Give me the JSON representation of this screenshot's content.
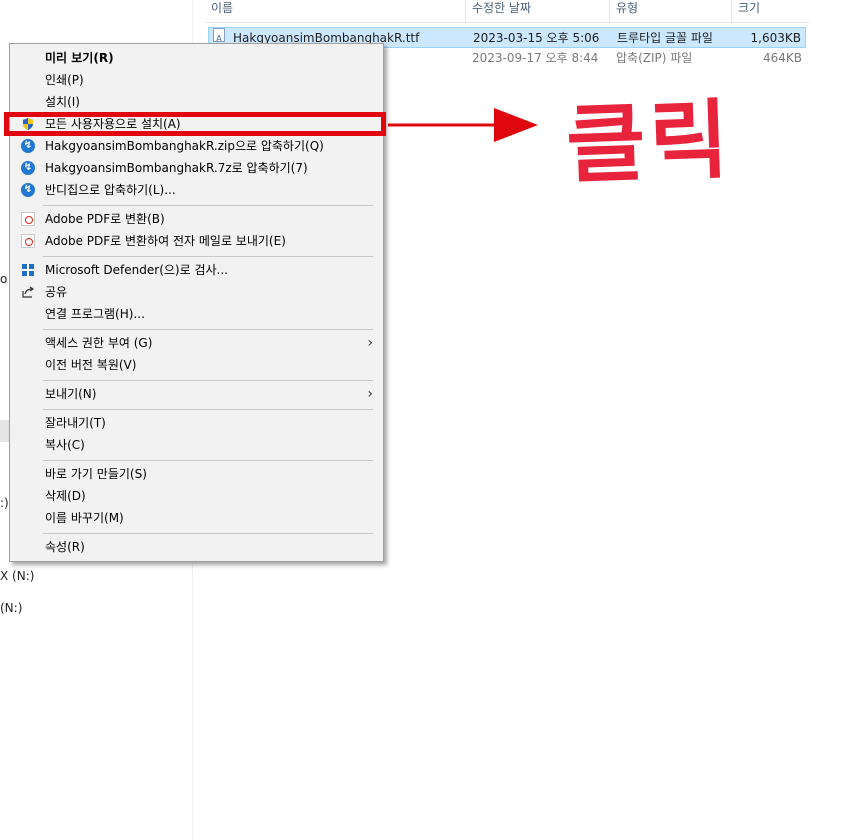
{
  "navigation": {
    "fragments": [
      "o",
      ":)",
      "X (N:)",
      "(N:)"
    ]
  },
  "file_list": {
    "columns": [
      "이름",
      "수정한 날짜",
      "유형",
      "크기"
    ],
    "rows": [
      {
        "name": "HakgyoansimBombanghakR.ttf",
        "date": "2023-03-15 오후 5:06",
        "type": "트루타입 글꼴 파일",
        "size": "1,603KB",
        "selected": true
      },
      {
        "name": "",
        "date": "2023-09-17 오후 8:44",
        "type": "압축(ZIP) 파일",
        "size": "464KB",
        "selected": false
      }
    ]
  },
  "context_menu": {
    "items": [
      {
        "label": "미리 보기(R)",
        "bold": true,
        "icon": ""
      },
      {
        "label": "인쇄(P)",
        "icon": ""
      },
      {
        "label": "설치(I)",
        "icon": ""
      },
      {
        "label": "모든 사용자용으로 설치(A)",
        "icon": "shield-icon"
      },
      {
        "label": "HakgyoansimBombanghakR.zip으로 압축하기(Q)",
        "icon": "bandizip-icon"
      },
      {
        "label": "HakgyoansimBombanghakR.7z로 압축하기(7)",
        "icon": "bandizip-icon"
      },
      {
        "label": "반디집으로 압축하기(L)...",
        "icon": "bandizip-icon"
      },
      {
        "label": "Adobe PDF로 변환(B)",
        "icon": "pdf-icon"
      },
      {
        "label": "Adobe PDF로 변환하여 전자 메일로 보내기(E)",
        "icon": "pdf-mail-icon"
      },
      {
        "label": "Microsoft Defender(으)로 검사...",
        "icon": "defender-icon"
      },
      {
        "label": "공유",
        "icon": "share-icon"
      },
      {
        "label": "연결 프로그램(H)...",
        "icon": ""
      },
      {
        "label": "액세스 권한 부여 (G)",
        "icon": "",
        "submenu": true
      },
      {
        "label": "이전 버전 복원(V)",
        "icon": ""
      },
      {
        "label": "보내기(N)",
        "icon": "",
        "submenu": true
      },
      {
        "label": "잘라내기(T)",
        "icon": ""
      },
      {
        "label": "복사(C)",
        "icon": ""
      },
      {
        "label": "바로 가기 만들기(S)",
        "icon": ""
      },
      {
        "label": "삭제(D)",
        "icon": ""
      },
      {
        "label": "이름 바꾸기(M)",
        "icon": ""
      },
      {
        "label": "속성(R)",
        "icon": ""
      }
    ],
    "submenu_arrow": "›"
  },
  "annotation": {
    "text": "클릭",
    "color": "#e0060d"
  }
}
